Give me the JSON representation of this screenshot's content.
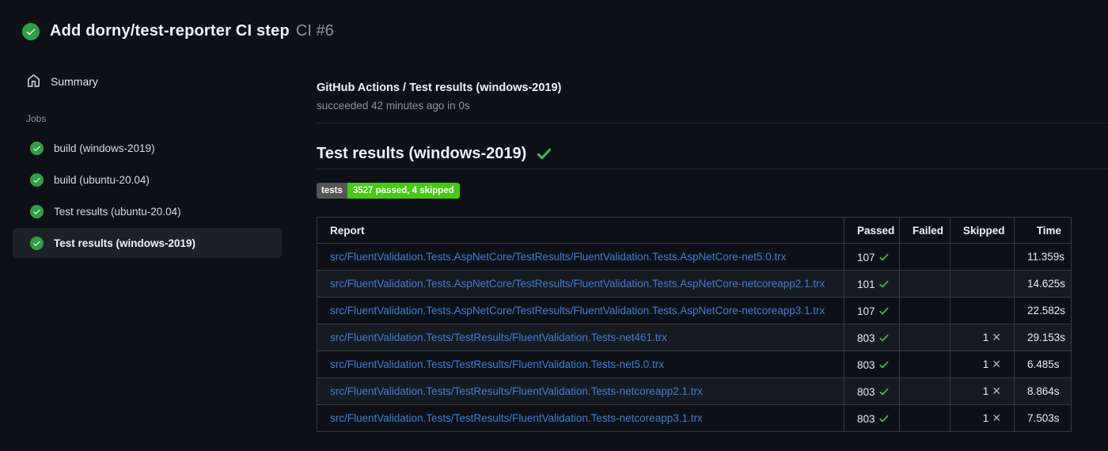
{
  "header": {
    "title": "Add dorny/test-reporter CI step",
    "run_number": "CI #6",
    "status_icon": "check-circle-icon"
  },
  "sidebar": {
    "summary_label": "Summary",
    "summary_icon": "home-icon",
    "jobs_label": "Jobs",
    "jobs": [
      {
        "label": "build (windows-2019)",
        "selected": false
      },
      {
        "label": "build (ubuntu-20.04)",
        "selected": false
      },
      {
        "label": "Test results (ubuntu-20.04)",
        "selected": false
      },
      {
        "label": "Test results (windows-2019)",
        "selected": true
      }
    ]
  },
  "main": {
    "job_header": {
      "title": "GitHub Actions / Test results (windows-2019)",
      "status_line": "succeeded 42 minutes ago in 0s"
    },
    "section_title": "Test results (windows-2019)",
    "badge": {
      "label": "tests",
      "value": "3527 passed, 4 skipped"
    },
    "table": {
      "columns": [
        "Report",
        "Passed",
        "Failed",
        "Skipped",
        "Time"
      ],
      "rows": [
        {
          "report": "src/FluentValidation.Tests.AspNetCore/TestResults/FluentValidation.Tests.AspNetCore-net5.0.trx",
          "passed": "107",
          "failed": "",
          "skipped": "",
          "time": "11.359s"
        },
        {
          "report": "src/FluentValidation.Tests.AspNetCore/TestResults/FluentValidation.Tests.AspNetCore-netcoreapp2.1.trx",
          "passed": "101",
          "failed": "",
          "skipped": "",
          "time": "14.625s"
        },
        {
          "report": "src/FluentValidation.Tests.AspNetCore/TestResults/FluentValidation.Tests.AspNetCore-netcoreapp3.1.trx",
          "passed": "107",
          "failed": "",
          "skipped": "",
          "time": "22.582s"
        },
        {
          "report": "src/FluentValidation.Tests/TestResults/FluentValidation.Tests-net461.trx",
          "passed": "803",
          "failed": "",
          "skipped": "1",
          "time": "29.153s"
        },
        {
          "report": "src/FluentValidation.Tests/TestResults/FluentValidation.Tests-net5.0.trx",
          "passed": "803",
          "failed": "",
          "skipped": "1",
          "time": "6.485s"
        },
        {
          "report": "src/FluentValidation.Tests/TestResults/FluentValidation.Tests-netcoreapp2.1.trx",
          "passed": "803",
          "failed": "",
          "skipped": "1",
          "time": "8.864s"
        },
        {
          "report": "src/FluentValidation.Tests/TestResults/FluentValidation.Tests-netcoreapp3.1.trx",
          "passed": "803",
          "failed": "",
          "skipped": "1",
          "time": "7.503s"
        }
      ]
    }
  },
  "colors": {
    "background": "#0d1117",
    "row_alt": "#161b22",
    "table_border": "#343b44",
    "status_circle_green": "#2ea043",
    "check_green": "#3fb950",
    "link_blue": "#3d7dd8",
    "badge_label_bg": "#555555",
    "badge_value_bg": "#44cc11",
    "muted_text": "#8b949e",
    "selected_item_bg": "#1c2128"
  }
}
